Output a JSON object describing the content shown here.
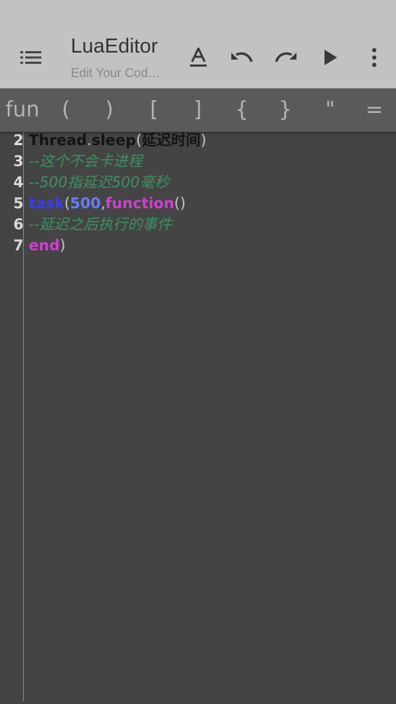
{
  "appbar": {
    "title": "LuaEditor",
    "subtitle": "Edit Your Cod…",
    "icons": [
      "menu-icon",
      "format-font-icon",
      "undo-icon",
      "redo-icon",
      "play-icon",
      "more-vert-icon"
    ],
    "background": "#c2c2c2"
  },
  "symbols": [
    "fun",
    "(",
    ")",
    "[",
    "]",
    "{",
    "}",
    "\"",
    "="
  ],
  "editor": {
    "background": "#444444",
    "lines": [
      {
        "num": "2",
        "tokens": [
          "Thread",
          ".",
          "sleep",
          "(",
          "延迟时间",
          ")"
        ]
      },
      {
        "num": "3",
        "tokens": [
          "--这个不会卡进程"
        ]
      },
      {
        "num": "4",
        "tokens": [
          "--500指延迟500毫秒"
        ]
      },
      {
        "num": "5",
        "tokens": [
          "task",
          "(",
          "500",
          ",",
          "function",
          "()"
        ]
      },
      {
        "num": "6",
        "tokens": [
          "--延迟之后执行的事件"
        ]
      },
      {
        "num": "7",
        "tokens": [
          "end",
          ")"
        ]
      }
    ],
    "colors": {
      "comment": "#3f8f63",
      "keyword_blue": "#3b3bf0",
      "number": "#6a7bff",
      "keyword_magenta": "#d13ed1",
      "identifier_dark": "#141414"
    }
  }
}
